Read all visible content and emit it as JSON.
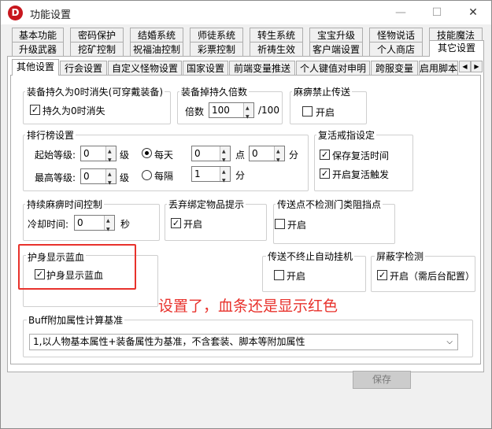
{
  "window": {
    "title": "功能设置",
    "app_icon_letter": "D",
    "minimize": "—",
    "maximize": "☐",
    "close": "✕"
  },
  "tabs_row1": [
    "基本功能",
    "密码保护",
    "结婚系统",
    "师徒系统",
    "转生系统",
    "宝宝升级",
    "怪物说话",
    "技能魔法"
  ],
  "tabs_row2": [
    "升级武器",
    "挖矿控制",
    "祝福油控制",
    "彩票控制",
    "祈祷生效",
    "客户端设置",
    "个人商店",
    "其它设置"
  ],
  "subtabs": [
    "其他设置",
    "行会设置",
    "自定义怪物设置",
    "国家设置",
    "前端变量推送",
    "个人键值对申明",
    "跨服变量",
    "启用脚本"
  ],
  "scroll": {
    "left": "◀",
    "right": "▶"
  },
  "group_durability": {
    "title": "装备持久为0时消失(可穿戴装备)",
    "checkbox": "持久为0时消失",
    "checked": true
  },
  "group_drop_multiplier": {
    "title": "装备掉持久倍数",
    "label": "倍数",
    "value": "100",
    "suffix": "/100"
  },
  "group_paralysis_teleport": {
    "title": "麻痹禁止传送",
    "checkbox": "开启",
    "checked": false
  },
  "group_ranking": {
    "title": "排行榜设置",
    "start_level_label": "起始等级:",
    "start_level_value": "0",
    "level_unit": "级",
    "max_level_label": "最高等级:",
    "max_level_value": "0",
    "radio_daily": "每天",
    "radio_interval": "每隔",
    "day_value": "0",
    "point_label": "点",
    "minute_value": "0",
    "minute_label": "分",
    "interval_value": "1",
    "interval_unit": "分"
  },
  "group_revive": {
    "title": "复活戒指设定",
    "save_time": "保存复活时间",
    "trigger": "开启复活触发"
  },
  "group_paralysis_duration": {
    "title": "持续麻痹时间控制",
    "cooldown_label": "冷却时间:",
    "cooldown_value": "0",
    "unit": "秒"
  },
  "group_discard_bound": {
    "title": "丢弃绑定物品提示",
    "checkbox": "开启",
    "checked": true
  },
  "group_teleport_block": {
    "title": "传送点不检测门类阻挡点",
    "checkbox": "开启",
    "checked": false
  },
  "group_shield_blue": {
    "title": "护身显示蓝血",
    "checkbox": "护身显示蓝血",
    "checked": true
  },
  "group_auto_hang": {
    "title": "传送不终止自动挂机",
    "checkbox": "开启",
    "checked": false
  },
  "group_mask_word": {
    "title": "屏蔽字检测",
    "checkbox": "开启（需后台配置）",
    "checked": true
  },
  "annotation": "设置了，血条还是显示红色",
  "group_buff": {
    "title": "Buff附加属性计算基准",
    "selected": "1,以人物基本属性+装备属性为基准，不含套装、脚本等附加属性"
  },
  "save_button": "保存",
  "colors": {
    "annotation_red": "#e8322c",
    "brand_red": "#c8171e"
  }
}
